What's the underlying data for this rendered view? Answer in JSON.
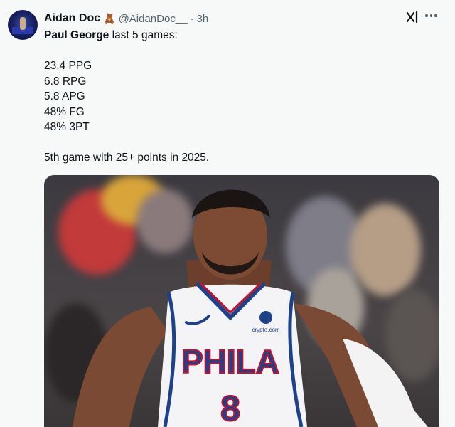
{
  "author": {
    "name": "Aidan Doc",
    "emoji": "🧸",
    "handle": "@AidanDoc__",
    "separator": "·",
    "time": "3h"
  },
  "tweet": {
    "lead_name": "Paul George",
    "lead_rest": " last 5 games:",
    "stats": [
      "23.4 PPG",
      "6.8 RPG",
      "5.8 APG",
      "48% FG",
      "48% 3PT"
    ],
    "closing": "5th game with 25+ points in 2025."
  },
  "image": {
    "jersey_text": "PHILA",
    "jersey_number": "8",
    "sponsor": "crypto.com"
  },
  "colors": {
    "accent": "#1d9bf0",
    "jersey_blue": "#1d428a",
    "jersey_red": "#c8102e"
  }
}
